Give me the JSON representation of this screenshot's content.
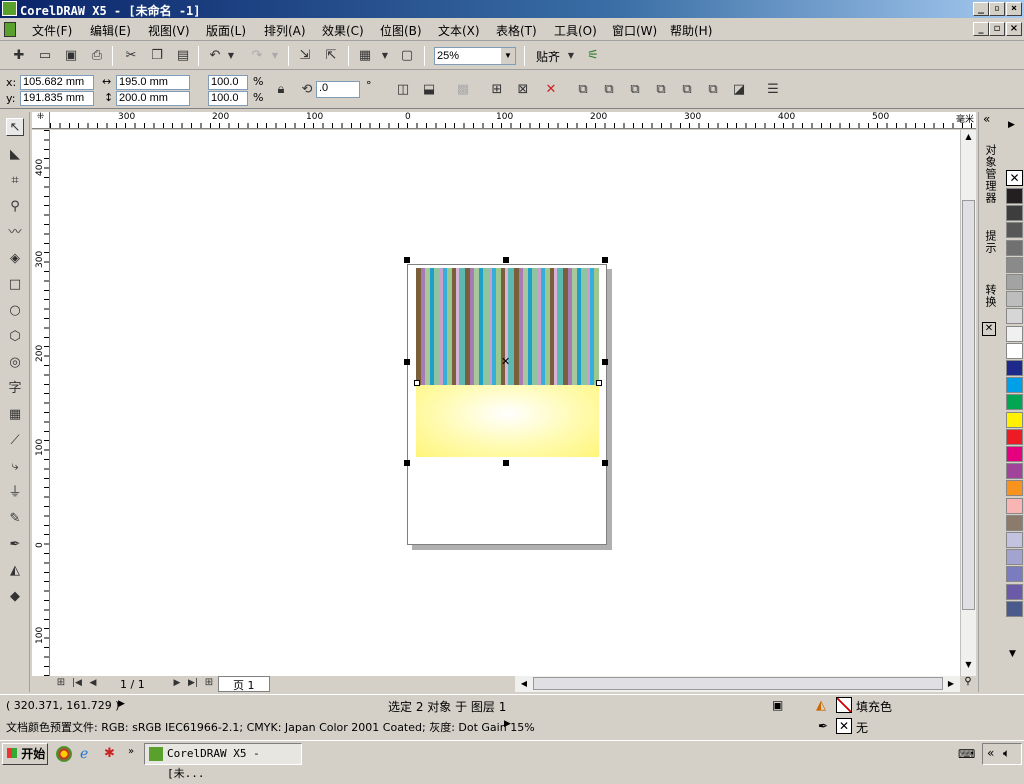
{
  "titlebar": {
    "title": "CorelDRAW X5 - [未命名 -1]"
  },
  "menu": [
    "文件(F)",
    "编辑(E)",
    "视图(V)",
    "版面(L)",
    "排列(A)",
    "效果(C)",
    "位图(B)",
    "文本(X)",
    "表格(T)",
    "工具(O)",
    "窗口(W)",
    "帮助(H)"
  ],
  "toolbar": {
    "zoom": "25%",
    "snap_label": "贴齐"
  },
  "property_bar": {
    "x_label": "x:",
    "x_value": "105.682 mm",
    "y_label": "y:",
    "y_value": "191.835 mm",
    "width_value": "195.0 mm",
    "height_value": "200.0 mm",
    "scale_w": "100.0",
    "scale_h": "100.0",
    "percent": "%",
    "angle": ".0",
    "degree": "°"
  },
  "ruler_top": {
    "labels": [
      "300",
      "200",
      "100",
      "0",
      "100",
      "200",
      "300",
      "400",
      "500"
    ],
    "unit": "毫米"
  },
  "ruler_left": {
    "labels": [
      "400",
      "300",
      "200",
      "100",
      "0",
      "100"
    ]
  },
  "page_nav": {
    "counter": "1 / 1",
    "tab": "页 1"
  },
  "docker": {
    "tabs": [
      "对象管理器",
      "提示",
      "转换"
    ]
  },
  "palette": {
    "colors": [
      "#231f20",
      "#3d3d3d",
      "#575757",
      "#707070",
      "#8a8a8a",
      "#a3a3a3",
      "#bdbdbd",
      "#d6d6d6",
      "#f0f0f0",
      "#ffffff",
      "#1e2a8a",
      "#00a0e9",
      "#00a651",
      "#fff100",
      "#ed1c24",
      "#e4007f",
      "#a0449a",
      "#f7931e",
      "#f9b4b4",
      "#8c7b6b",
      "#c3c3e0",
      "#a3a3d0",
      "#7b7bc0",
      "#6a5aa8",
      "#4a5a8a"
    ]
  },
  "status": {
    "coords": "( 320.371, 161.729 )",
    "selection": "选定 2 对象 于 图层 1",
    "fill_label": "填充色",
    "outline_label": "无",
    "profile": "文档颜色预置文件: RGB: sRGB IEC61966-2.1; CMYK: Japan Color 2001 Coated; 灰度: Dot Gain 15%"
  },
  "taskbar": {
    "start": "开始",
    "task": "CorelDRAW X5 - [未..."
  }
}
